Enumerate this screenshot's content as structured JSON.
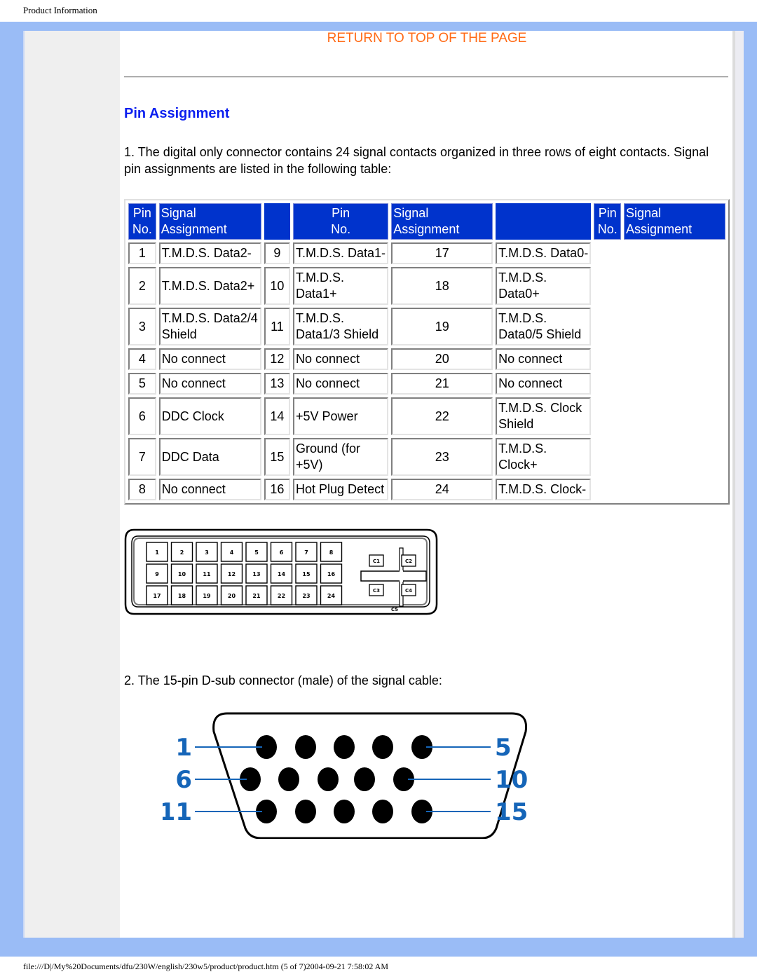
{
  "header": {
    "title": "Product Information"
  },
  "nav": {
    "return_top": "RETURN TO TOP OF THE PAGE"
  },
  "section": {
    "title": "Pin Assignment",
    "intro": "1. The digital only connector contains 24 signal contacts organized in three rows of eight contacts. Signal pin assignments are listed in the following table:",
    "dsub_intro": "2. The 15-pin D-sub connector (male) of the signal cable:"
  },
  "table": {
    "col_pin": "Pin No.",
    "col_pin_line1": "Pin",
    "col_pin_line2": "No.",
    "col_signal": "Signal Assignment",
    "groups": [
      [
        {
          "pin": "1",
          "signal": "T.M.D.S. Data2-"
        },
        {
          "pin": "2",
          "signal": "T.M.D.S. Data2+"
        },
        {
          "pin": "3",
          "signal": "T.M.D.S. Data2/4 Shield"
        },
        {
          "pin": "4",
          "signal": "No connect"
        },
        {
          "pin": "5",
          "signal": "No connect"
        },
        {
          "pin": "6",
          "signal": "DDC Clock"
        },
        {
          "pin": "7",
          "signal": "DDC Data"
        },
        {
          "pin": "8",
          "signal": "No connect"
        }
      ],
      [
        {
          "pin": "9",
          "signal": "T.M.D.S. Data1-"
        },
        {
          "pin": "10",
          "signal": "T.M.D.S. Data1+"
        },
        {
          "pin": "11",
          "signal": "T.M.D.S. Data1/3 Shield"
        },
        {
          "pin": "12",
          "signal": "No connect"
        },
        {
          "pin": "13",
          "signal": "No connect"
        },
        {
          "pin": "14",
          "signal": "+5V Power"
        },
        {
          "pin": "15",
          "signal": "Ground (for +5V)"
        },
        {
          "pin": "16",
          "signal": "Hot Plug Detect"
        }
      ],
      [
        {
          "pin": "17",
          "signal": "T.M.D.S. Data0-"
        },
        {
          "pin": "18",
          "signal": "T.M.D.S. Data0+"
        },
        {
          "pin": "19",
          "signal": "T.M.D.S. Data0/5 Shield"
        },
        {
          "pin": "20",
          "signal": "No connect"
        },
        {
          "pin": "21",
          "signal": "No connect"
        },
        {
          "pin": "22",
          "signal": "T.M.D.S. Clock Shield"
        },
        {
          "pin": "23",
          "signal": "T.M.D.S. Clock+"
        },
        {
          "pin": "24",
          "signal": "T.M.D.S. Clock-"
        }
      ]
    ]
  },
  "dvi_diagram": {
    "pins": [
      "1",
      "2",
      "3",
      "4",
      "5",
      "6",
      "7",
      "8",
      "9",
      "10",
      "11",
      "12",
      "13",
      "14",
      "15",
      "16",
      "17",
      "18",
      "19",
      "20",
      "21",
      "22",
      "23",
      "24"
    ],
    "analog": [
      "C1",
      "C2",
      "C3",
      "C4",
      "C5"
    ]
  },
  "vga_diagram": {
    "labels_left": [
      "1",
      "6",
      "11"
    ],
    "labels_right": [
      "5",
      "10",
      "15"
    ]
  },
  "colors": {
    "frame": "#9abcf6",
    "link": "#ff6b17",
    "heading": "#0b1fef",
    "table_header": "#0033cc",
    "vga_label": "#1565b8"
  },
  "footer": {
    "path": "file:///D|/My%20Documents/dfu/230W/english/230w5/product/product.htm (5 of 7)2004-09-21 7:58:02 AM"
  }
}
